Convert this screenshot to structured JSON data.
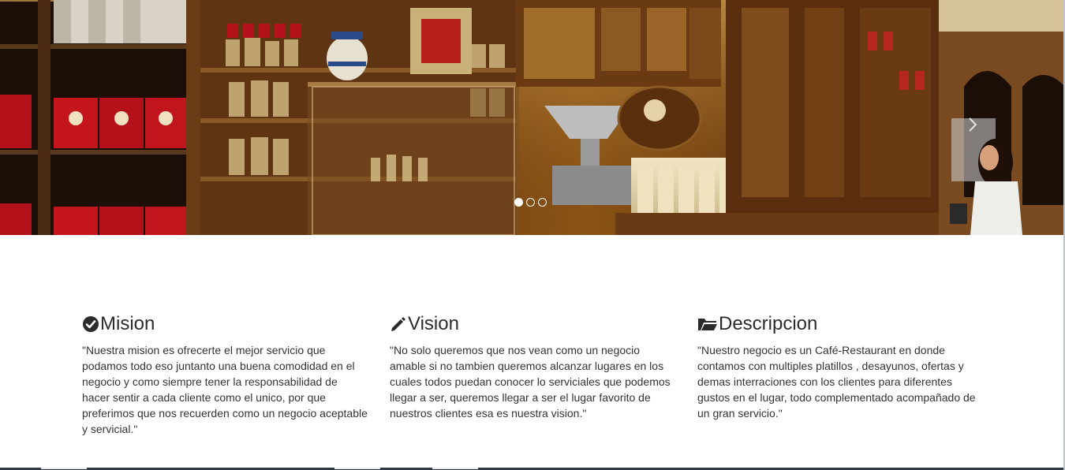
{
  "carousel": {
    "slides": [
      {
        "alt": "tea shop interior",
        "active": true
      },
      {
        "alt": "",
        "active": false
      },
      {
        "alt": "",
        "active": false
      }
    ],
    "next_icon": "chevron-right-icon"
  },
  "sections": [
    {
      "icon": "check-circle-icon",
      "title": "Mision",
      "text": "\"Nuestra mision es ofrecerte el mejor servicio que podamos todo eso juntanto una buena comodidad en el negocio y como siempre tener la responsabilidad de hacer sentir a cada cliente como el unico, por que preferimos que nos recuerden como un negocio aceptable y servicial.\""
    },
    {
      "icon": "pencil-icon",
      "title": "Vision",
      "text": "\"No solo queremos que nos vean como un negocio amable si no tambien queremos alcanzar lugares en los cuales todos puedan conocer lo serviciales que podemos llegar a ser, queremos llegar a ser el lugar favorito de nuestros clientes esa es nuestra vision.\""
    },
    {
      "icon": "folder-open-icon",
      "title": "Descripcion",
      "text": "\"Nuestro negocio es un Café-Restaurant en donde contamos con multiples platillos , desayunos, ofertas y demas interraciones con los clientes para diferentes gustos en el lugar, todo complementado acompañado de un gran servicio.\""
    }
  ],
  "colors": {
    "heading": "#2b2b2b",
    "body_text": "#333333",
    "footer_bar": "#2f3a47"
  }
}
